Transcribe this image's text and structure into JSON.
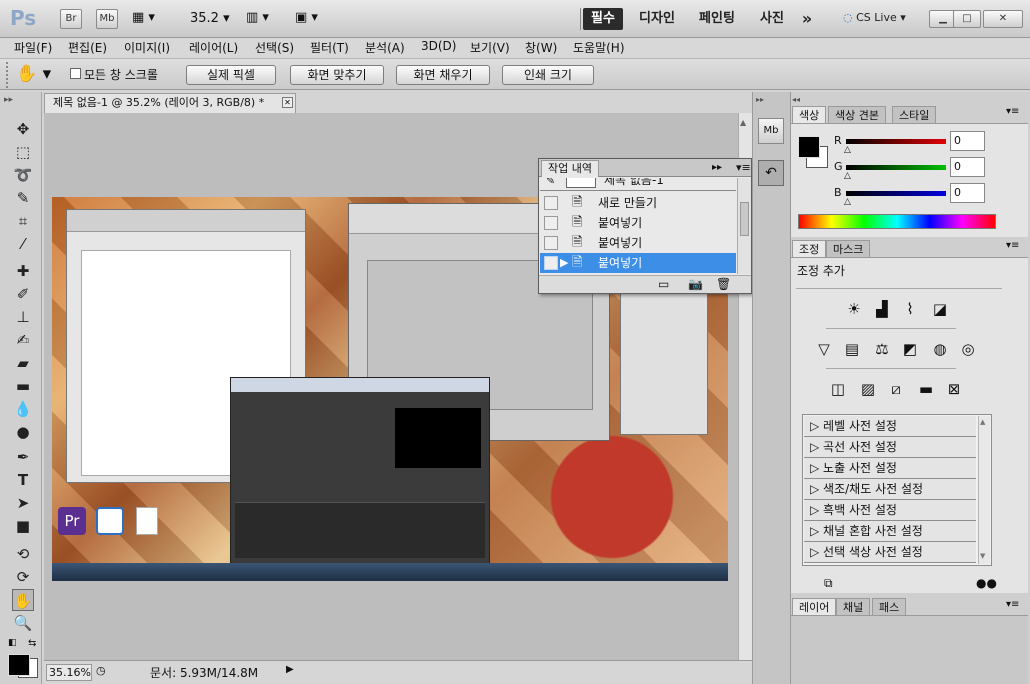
{
  "app_bar": {
    "logo": "Ps",
    "br_label": "Br",
    "mb_label": "Mb",
    "zoom_value": "35.2",
    "workspaces": [
      "필수",
      "디자인",
      "페인팅",
      "사진"
    ],
    "more_label": "»",
    "cs_live": "CS Live"
  },
  "menus": [
    "파일(F)",
    "편집(E)",
    "이미지(I)",
    "레이어(L)",
    "선택(S)",
    "필터(T)",
    "분석(A)",
    "3D(D)",
    "보기(V)",
    "창(W)",
    "도움말(H)"
  ],
  "options": {
    "scroll_all_label": "모든 창 스크롤",
    "buttons": [
      "실제 픽셀",
      "화면 맞추기",
      "화면 채우기",
      "인쇄 크기"
    ]
  },
  "document": {
    "tab_title": "제목 없음-1 @ 35.2% (레이어 3, RGB/8) *",
    "zoom_status": "35.16%",
    "doc_size": "문서: 5.93M/14.8M"
  },
  "history": {
    "title": "작업 내역",
    "snapshot_label": "제목 없음-1",
    "items": [
      "새로 만들기",
      "붙여넣기",
      "붙여넣기",
      "붙여넣기"
    ],
    "selected_index": 3
  },
  "color_panel": {
    "tabs": [
      "색상",
      "색상 견본",
      "스타일"
    ],
    "channels": [
      {
        "label": "R",
        "value": "0",
        "color": "#e00000"
      },
      {
        "label": "G",
        "value": "0",
        "color": "#00b000"
      },
      {
        "label": "B",
        "value": "0",
        "color": "#0000e0"
      }
    ]
  },
  "adjust_panel": {
    "tabs": [
      "조정",
      "마스크"
    ],
    "title": "조정 추가",
    "presets": [
      "레벨 사전 설정",
      "곡선 사전 설정",
      "노출 사전 설정",
      "색조/채도 사전 설정",
      "흑백 사전 설정",
      "채널 혼합 사전 설정",
      "선택 색상 사전 설정"
    ]
  },
  "layers_panel": {
    "tabs": [
      "레이어",
      "채널",
      "패스"
    ]
  },
  "colors": {
    "selected_row": "#3d8ee6",
    "foreground": "#000000",
    "background": "#ffffff"
  }
}
